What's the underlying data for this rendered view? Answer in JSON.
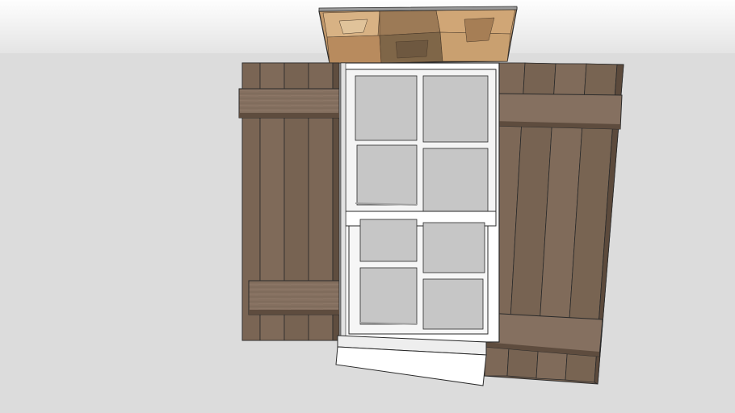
{
  "colors": {
    "sky_top": "#fdfdfd",
    "sky_bottom": "#e6e6e6",
    "ground": "#dcdcdc",
    "shutter_wood": "#7a6655",
    "shutter_wood_dark": "#5e4c3e",
    "shutter_batten": "#8a7563",
    "window_frame": "#ffffff",
    "window_glass": "#c8c8c8",
    "stone_base": "#c49a6c",
    "outline": "#2a2a2a"
  }
}
